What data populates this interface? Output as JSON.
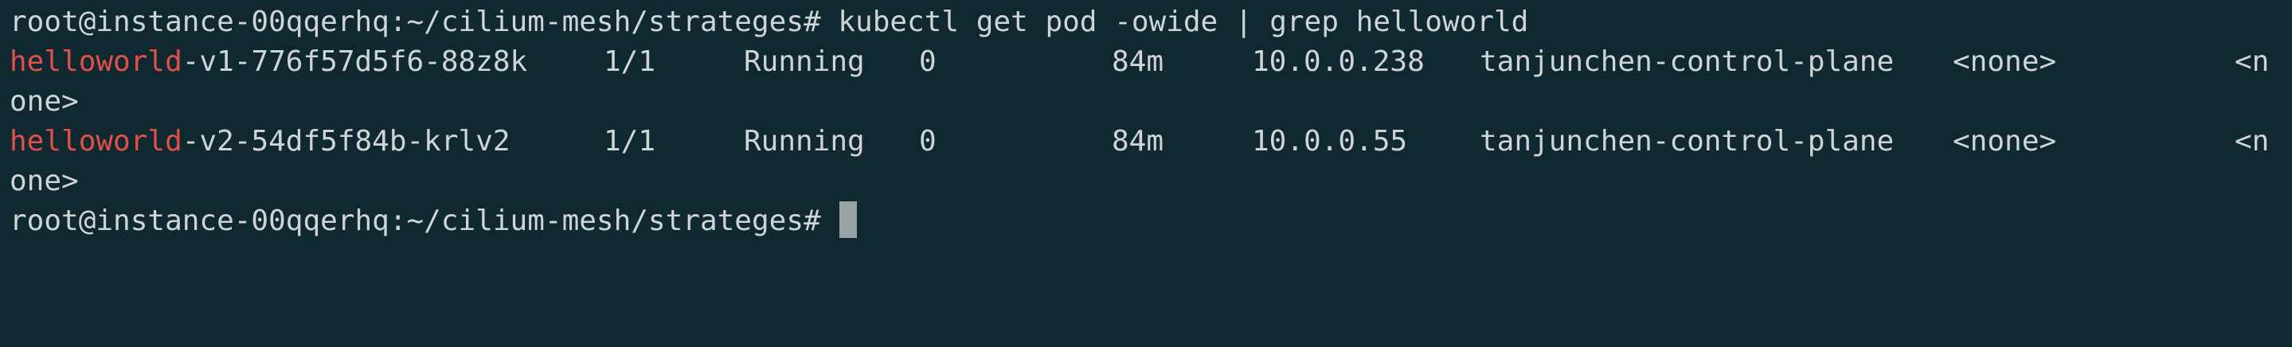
{
  "terminal": {
    "prompt": "root@instance-00qqerhq:~/cilium-mesh/strateges#",
    "command": "kubectl get pod -owide | grep helloworld",
    "grep_match": "helloworld",
    "rows": [
      {
        "name_suffix": "-v1-776f57d5f6-88z8k",
        "ready": "1/1",
        "status": "Running",
        "restarts": "0",
        "age": "84m",
        "ip": "10.0.0.238",
        "node": "tanjunchen-control-plane",
        "nominated_node": "<none>",
        "readiness_gates_part1": "<n",
        "readiness_gates_part2": "one>"
      },
      {
        "name_suffix": "-v2-54df5f84b-krlv2",
        "ready": "1/1",
        "status": "Running",
        "restarts": "0",
        "age": "84m",
        "ip": "10.0.0.55",
        "node": "tanjunchen-control-plane",
        "nominated_node": "<none>",
        "readiness_gates_part1": "<n",
        "readiness_gates_part2": "one>"
      }
    ],
    "colors": {
      "background": "#10282f",
      "text": "#cfd4d6",
      "grep_highlight": "#e0504a",
      "cursor": "#9aa2a6"
    }
  }
}
